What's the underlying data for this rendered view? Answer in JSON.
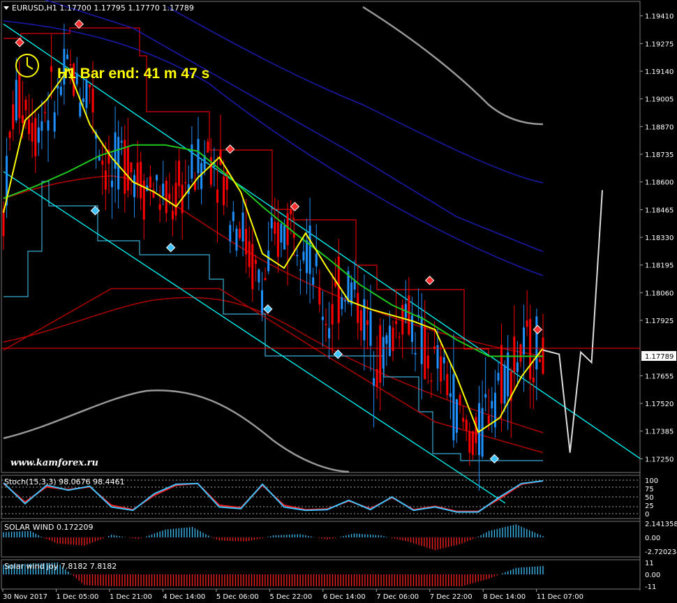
{
  "colors": {
    "background": "#000000",
    "bull_candle": "#1e90ff",
    "bear_candle": "#ff0000",
    "fast_ma": "#ffff00",
    "slow_ma": "#1ec81e",
    "channel": "#00ffff",
    "bid_line": "#ff0000",
    "price_tag_bg": "#ffffff"
  },
  "header": {
    "title": "EURUSD,H1  1.17700 1.17795 1.17770 1.17789",
    "timer_text": "H1 Bar end: 41 m 47 s",
    "watermark": "www.kamforex.ru",
    "menu_icon": "triangle-down-icon",
    "clock_icon": "clock-icon"
  },
  "chart_data": [
    {
      "type": "line",
      "panel": "main",
      "title": "EURUSD,H1",
      "ohlc": {
        "open": 1.177,
        "high": 1.17795,
        "low": 1.1777,
        "close": 1.17789
      },
      "y_ticks": [
        "1.19410",
        "1.19275",
        "1.19140",
        "1.19005",
        "1.18870",
        "1.18735",
        "1.18600",
        "1.18465",
        "1.18330",
        "1.18195",
        "1.18060",
        "1.17925",
        "1.17789",
        "1.17655",
        "1.17520",
        "1.17385",
        "1.17250"
      ],
      "ylim": [
        1.1719,
        1.1946
      ],
      "current_price": "1.17789",
      "x_ticks": [
        "30 Nov 2017",
        "1 Dec 05:00",
        "1 Dec 21:00",
        "4 Dec 14:00",
        "5 Dec 06:00",
        "5 Dec 22:00",
        "6 Dec 14:00",
        "7 Dec 06:00",
        "7 Dec 22:00",
        "8 Dec 14:00",
        "11 Dec 07:00"
      ],
      "series": [
        {
          "role": "close",
          "x": [
            0,
            2,
            4,
            6,
            8,
            10,
            12,
            14,
            16,
            18,
            20,
            22,
            24,
            26,
            28,
            30,
            32,
            34,
            36,
            38,
            40,
            42,
            44,
            46,
            48,
            50,
            52,
            54,
            56,
            58,
            60,
            62,
            64,
            66,
            68,
            70,
            72,
            74,
            76,
            78,
            80,
            82,
            84,
            86,
            88,
            90,
            92,
            94,
            96,
            98,
            100,
            102
          ],
          "values": [
            1.1845,
            1.19,
            1.19,
            1.1885,
            1.1898,
            1.19,
            1.1915,
            1.1905,
            1.1908,
            1.1875,
            1.186,
            1.1873,
            1.1868,
            1.1858,
            1.1858,
            1.1848,
            1.1852,
            1.186,
            1.1868,
            1.1875,
            1.1868,
            1.1848,
            1.184,
            1.182,
            1.1808,
            1.1828,
            1.1838,
            1.1843,
            1.1832,
            1.181,
            1.1792,
            1.1805,
            1.1812,
            1.18,
            1.1784,
            1.1775,
            1.1785,
            1.1798,
            1.1792,
            1.1775,
            1.177,
            1.1765,
            1.1748,
            1.1738,
            1.1733,
            1.1755,
            1.1765,
            1.177,
            1.1776,
            1.1779,
            1.1779,
            1.1779
          ]
        },
        {
          "role": "fast_ma",
          "x": [
            0,
            4,
            8,
            12,
            16,
            20,
            24,
            28,
            32,
            36,
            40,
            44,
            48,
            52,
            56,
            60,
            64,
            68,
            72,
            76,
            80,
            84,
            88,
            92,
            96,
            100
          ],
          "values": [
            1.1845,
            1.189,
            1.19,
            1.1915,
            1.1888,
            1.1872,
            1.186,
            1.1855,
            1.1848,
            1.1862,
            1.1872,
            1.1855,
            1.1825,
            1.1818,
            1.1835,
            1.1818,
            1.1802,
            1.1798,
            1.1795,
            1.1792,
            1.1788,
            1.1765,
            1.1738,
            1.1745,
            1.1765,
            1.1779
          ]
        },
        {
          "role": "slow_ma",
          "x": [
            0,
            6,
            12,
            18,
            24,
            30,
            36,
            42,
            48,
            54,
            60,
            66,
            72,
            78,
            84,
            90,
            96,
            100
          ],
          "values": [
            1.1852,
            1.1858,
            1.1865,
            1.1873,
            1.1878,
            1.1878,
            1.1875,
            1.1862,
            1.1848,
            1.1835,
            1.1823,
            1.181,
            1.18,
            1.1793,
            1.1783,
            1.1775,
            1.1775,
            1.1775
          ]
        },
        {
          "role": "channel_upper",
          "x": [
            0,
            88
          ],
          "values": [
            1.1937,
            1.1779
          ]
        },
        {
          "role": "channel_lower",
          "x": [
            0,
            84
          ],
          "values": [
            1.1865,
            1.1719
          ]
        },
        {
          "role": "envelope_upper_blue",
          "x": [
            4,
            24,
            44,
            64,
            84,
            100
          ],
          "values": [
            1.1952,
            1.1935,
            1.1905,
            1.1875,
            1.1843,
            1.1826
          ]
        },
        {
          "role": "envelope_lower_red",
          "x": [
            0,
            20,
            40,
            60,
            80,
            100
          ],
          "values": [
            1.1778,
            1.1808,
            1.1808,
            1.1775,
            1.1743,
            1.1728
          ]
        },
        {
          "role": "forecast",
          "x": [
            100,
            103,
            105,
            107,
            109,
            111
          ],
          "values": [
            1.1778,
            1.1776,
            1.1728,
            1.1777,
            1.1772,
            1.1856
          ]
        }
      ]
    },
    {
      "type": "line",
      "panel": "stochastic",
      "label": "Stoch(15,3,3) 98.0676 98.4461",
      "y_ticks": [
        "100",
        "75",
        "50",
        "25",
        "0"
      ],
      "ylim": [
        0,
        100
      ],
      "series": [
        {
          "name": "main",
          "x": [
            0,
            4,
            8,
            12,
            16,
            20,
            24,
            28,
            32,
            36,
            40,
            44,
            48,
            52,
            56,
            60,
            64,
            68,
            72,
            76,
            80,
            84,
            88,
            92,
            96,
            100
          ],
          "values": [
            92,
            30,
            85,
            70,
            82,
            20,
            10,
            60,
            88,
            90,
            20,
            15,
            88,
            20,
            10,
            12,
            40,
            12,
            50,
            10,
            20,
            5,
            5,
            50,
            90,
            98
          ]
        },
        {
          "name": "signal",
          "x": [
            0,
            4,
            8,
            12,
            16,
            20,
            24,
            28,
            32,
            36,
            40,
            44,
            48,
            52,
            56,
            60,
            64,
            68,
            72,
            76,
            80,
            84,
            88,
            92,
            96,
            100
          ],
          "values": [
            90,
            35,
            80,
            72,
            80,
            25,
            12,
            55,
            85,
            90,
            25,
            18,
            85,
            25,
            12,
            14,
            38,
            15,
            48,
            12,
            22,
            7,
            7,
            45,
            88,
            98
          ]
        }
      ]
    },
    {
      "type": "bar",
      "panel": "solar_wind",
      "label": "SOLAR WIND 0.172209",
      "y_ticks": [
        "2.141358",
        "0.00",
        "-2.720234"
      ],
      "ylim": [
        -2.720234,
        2.141358
      ],
      "x": [
        0,
        5,
        10,
        15,
        20,
        25,
        30,
        35,
        40,
        45,
        50,
        55,
        60,
        65,
        70,
        75,
        80,
        85,
        90,
        95,
        100
      ],
      "values": [
        0.8,
        1.0,
        -1.2,
        -1.6,
        0.4,
        -0.3,
        1.2,
        1.6,
        -0.6,
        -0.8,
        0.3,
        0.5,
        -0.4,
        0.6,
        0.3,
        -0.8,
        -2.5,
        -1.2,
        1.0,
        2.0,
        0.2
      ]
    },
    {
      "type": "bar",
      "panel": "solar_wind_joy",
      "label": "Solar wind joy 7.8182 7.8182",
      "y_ticks": [
        "11",
        "0.00",
        "-11"
      ],
      "ylim": [
        -11,
        11
      ],
      "x": [
        0,
        5,
        10,
        15,
        20,
        25,
        30,
        35,
        40,
        45,
        50,
        55,
        60,
        65,
        70,
        75,
        80,
        85,
        90,
        95,
        100
      ],
      "values": [
        9,
        10,
        11,
        -10,
        -11,
        -11,
        -11,
        -11,
        -11,
        -11,
        -11,
        -11,
        -11,
        -11,
        -11,
        -11,
        -11,
        -11,
        -4,
        6,
        7.8182
      ]
    }
  ]
}
